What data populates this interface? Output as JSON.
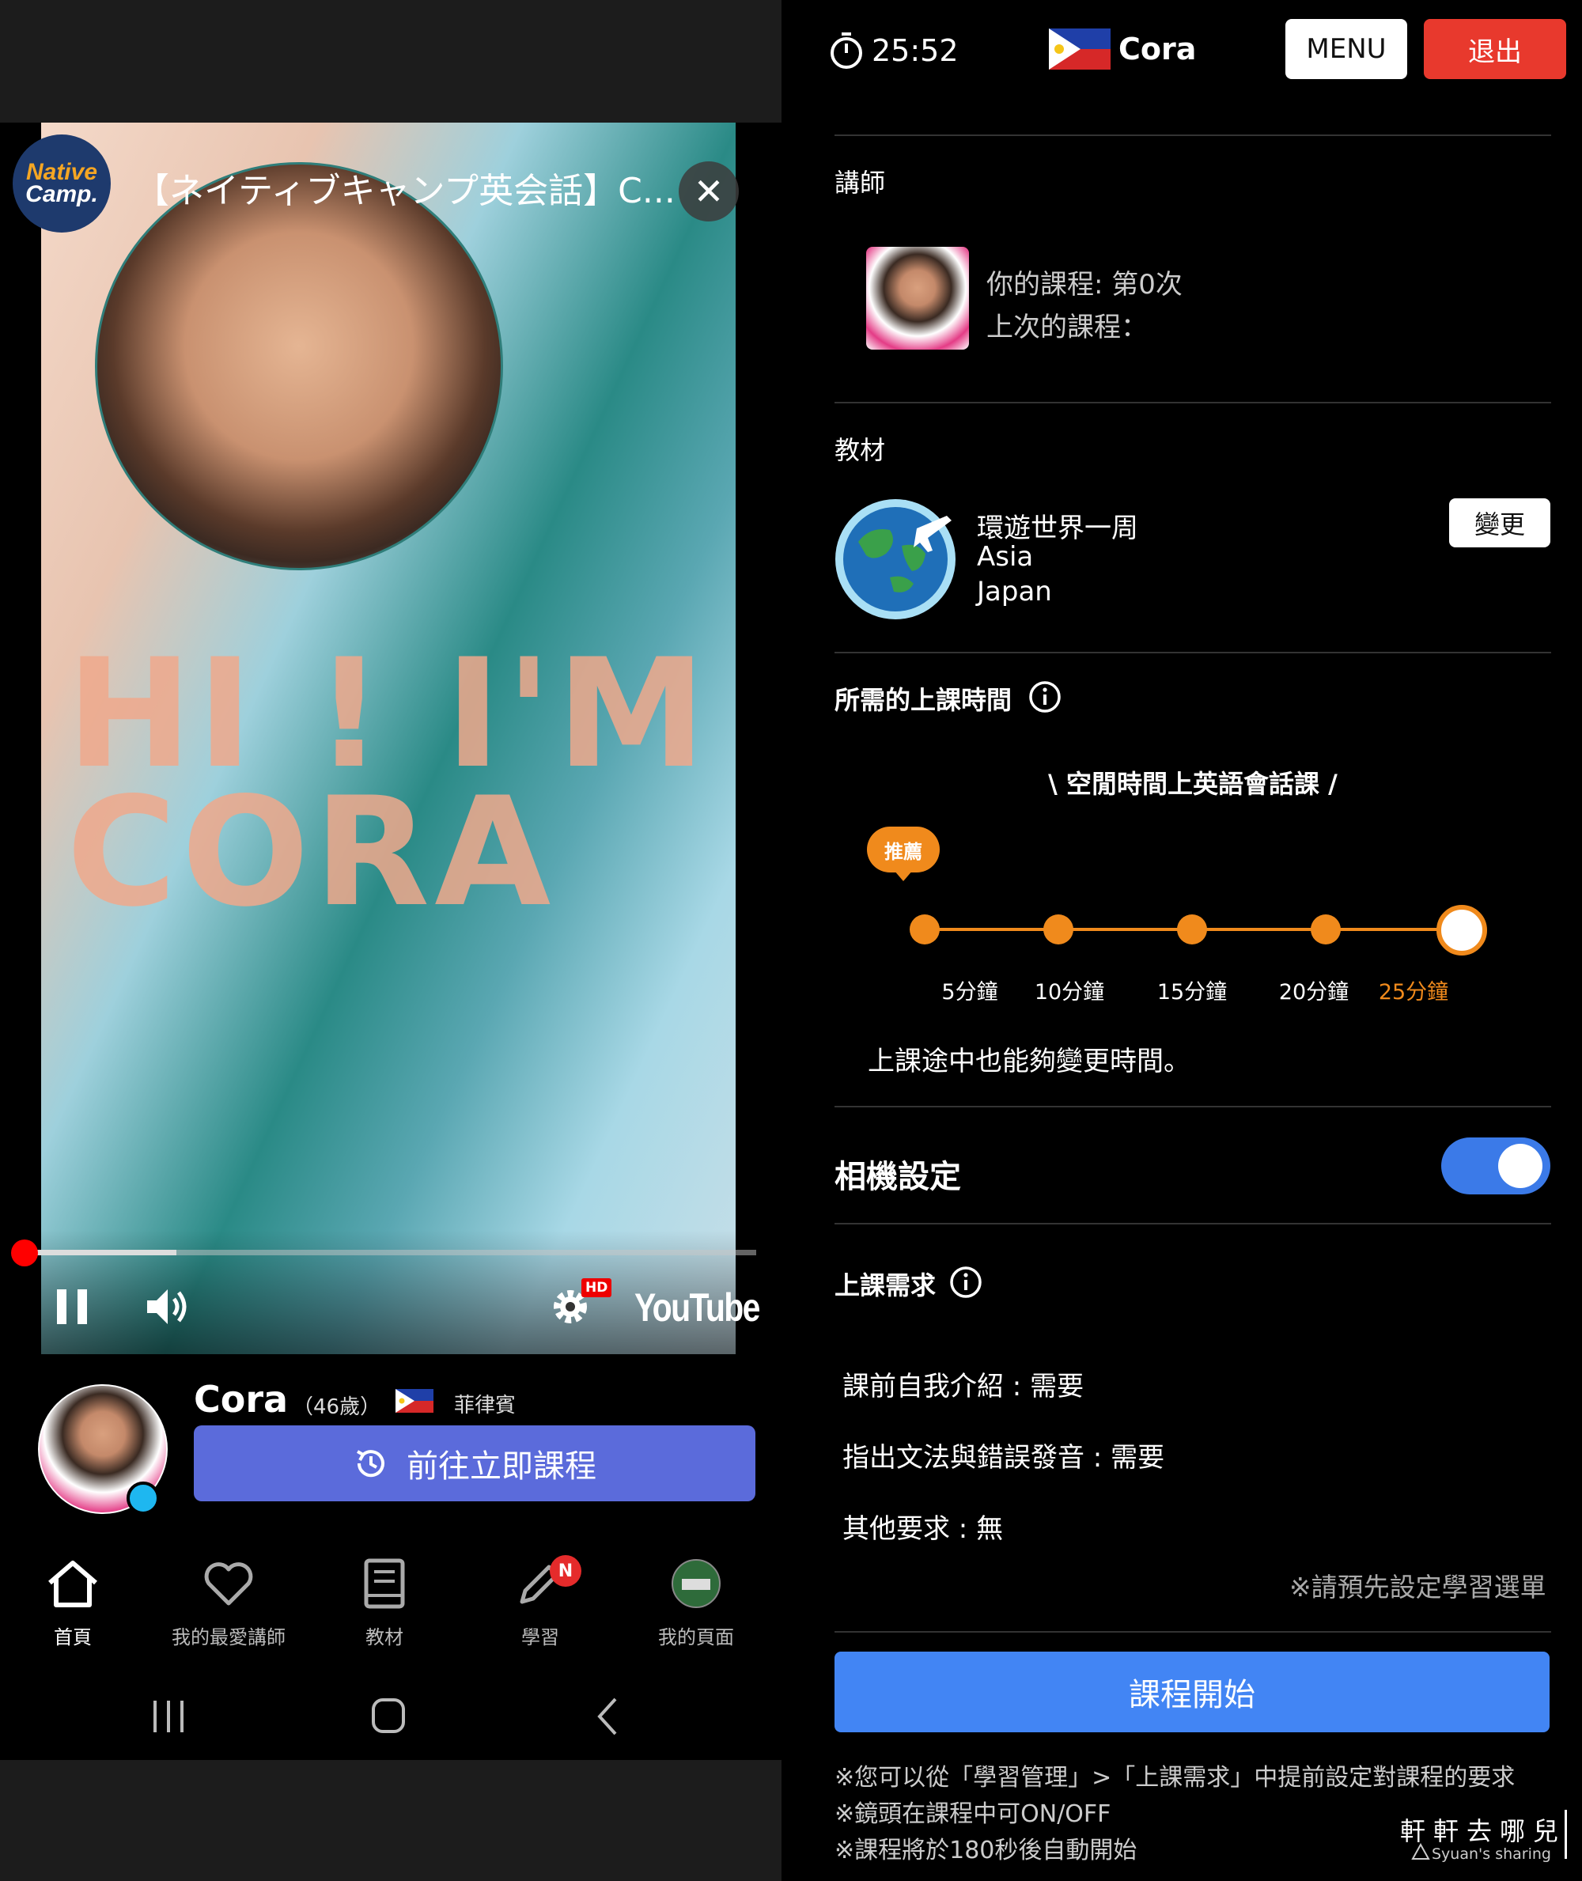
{
  "left": {
    "video": {
      "title": "【ネイティブキャンプ英会話】C...",
      "logo_line1": "Native",
      "logo_line2": "Camp.",
      "overlay_text": "HI ! I'M\nCORA",
      "hd_badge": "HD",
      "yt_logo": "YouTube",
      "progress_fraction": 0.21
    },
    "teacher": {
      "name": "Cora",
      "age": "（46歲）",
      "country": "菲律賓",
      "go_button": "前往立即課程"
    },
    "nav": {
      "items": [
        {
          "label": "首頁",
          "icon": "home-icon"
        },
        {
          "label": "我的最愛講師",
          "icon": "heart-icon"
        },
        {
          "label": "教材",
          "icon": "book-icon"
        },
        {
          "label": "學習",
          "icon": "pencil-icon"
        },
        {
          "label": "我的頁面",
          "icon": "profile-icon"
        }
      ],
      "badge": "N"
    }
  },
  "right": {
    "header": {
      "timer": "25:52",
      "name": "Cora",
      "menu_label": "MENU",
      "exit_label": "退出"
    },
    "tutor_section": {
      "title": "講師",
      "course_count": "你的課程: 第0次",
      "last_course": "上次的課程："
    },
    "material_section": {
      "title": "教材",
      "line1": "環遊世界一周",
      "line2": "Asia",
      "line3": "Japan",
      "change_label": "變更"
    },
    "duration_section": {
      "title": "所需的上課時間",
      "slogan": "\\ 空閒時間上英語會話課 /",
      "recommend": "推薦",
      "options": [
        "5分鐘",
        "10分鐘",
        "15分鐘",
        "20分鐘",
        "25分鐘"
      ],
      "selected_index": 4,
      "note": "上課途中也能夠變更時間。"
    },
    "camera_section": {
      "title": "相機設定",
      "enabled": true
    },
    "request_section": {
      "title": "上課需求",
      "items": [
        "課前自我介紹 : 需要",
        "指出文法與錯誤發音 : 需要",
        "其他要求 : 無"
      ],
      "preset_note": "※請預先設定學習選單"
    },
    "start_label": "課程開始",
    "footnotes": [
      "※您可以從「學習管理」>「上課需求」中提前設定對課程的要求",
      "※鏡頭在課程中可ON/OFF",
      "※課程將於180秒後自動開始"
    ],
    "watermark": {
      "cn": "軒軒去哪兒",
      "en": "Syuan's sharing"
    }
  },
  "colors": {
    "accent_orange": "#f08a1c",
    "go_button_blue": "#5b6bdb",
    "start_button_blue": "#4285f4",
    "exit_red": "#e8392d",
    "toggle_blue": "#3b7ae8"
  }
}
